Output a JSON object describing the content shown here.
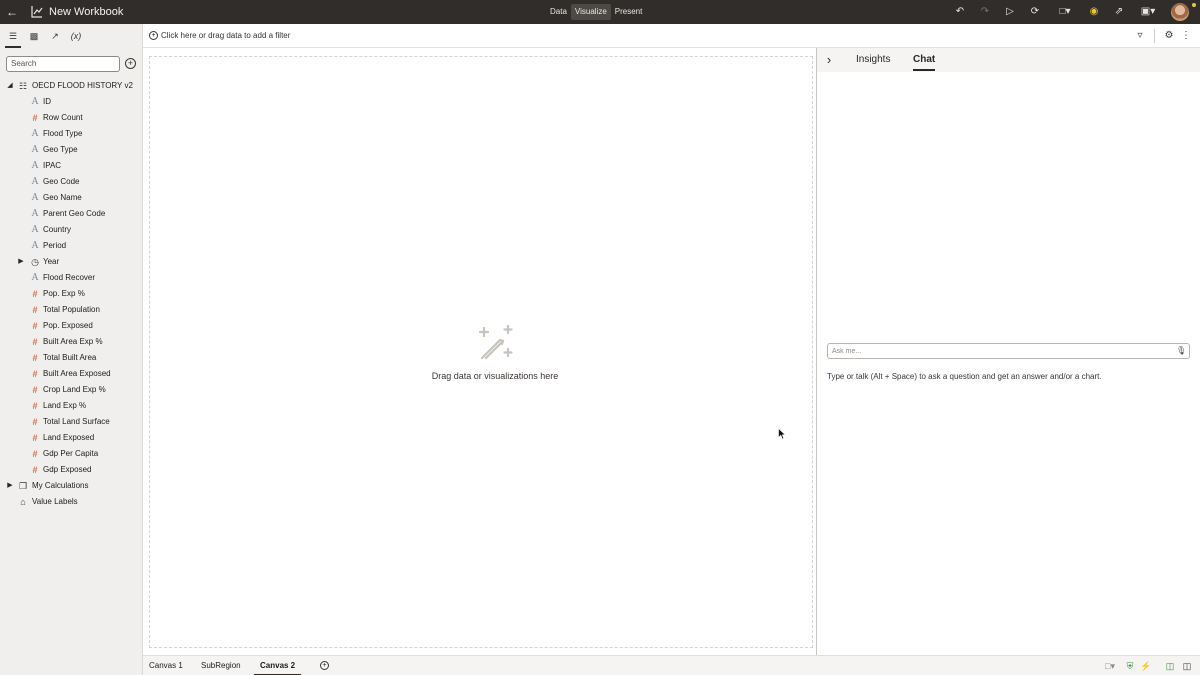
{
  "topbar": {
    "back_icon": "arrow-left-icon",
    "title": "New Workbook",
    "modes": [
      "Data",
      "Visualize",
      "Present"
    ],
    "active_mode": "Visualize",
    "icons": [
      "undo-icon",
      "redo-icon",
      "play-icon",
      "refresh-icon",
      "comment-icon",
      "bulb-icon",
      "export-icon",
      "save-icon",
      "avatar"
    ]
  },
  "left_panel": {
    "tab_icons": [
      "data-icon",
      "viz-icon",
      "analytics-icon",
      "calc-icon"
    ],
    "tab_labels": [
      "",
      "",
      "",
      "(x)"
    ],
    "search_placeholder": "Search",
    "dataset": "OECD FLOOD HISTORY v2",
    "fields": [
      {
        "label": "ID",
        "kind": "attribute"
      },
      {
        "label": "Row Count",
        "kind": "measure"
      },
      {
        "label": "Flood Type",
        "kind": "attribute"
      },
      {
        "label": "Geo Type",
        "kind": "attribute"
      },
      {
        "label": "IPAC",
        "kind": "attribute"
      },
      {
        "label": "Geo Code",
        "kind": "attribute"
      },
      {
        "label": "Geo Name",
        "kind": "attribute"
      },
      {
        "label": "Parent Geo Code",
        "kind": "attribute"
      },
      {
        "label": "Country",
        "kind": "attribute"
      },
      {
        "label": "Period",
        "kind": "attribute"
      },
      {
        "label": "Year",
        "kind": "time"
      },
      {
        "label": "Flood Recover",
        "kind": "attribute"
      },
      {
        "label": "Pop. Exp %",
        "kind": "measure"
      },
      {
        "label": "Total Population",
        "kind": "measure"
      },
      {
        "label": "Pop. Exposed",
        "kind": "measure"
      },
      {
        "label": "Built Area Exp %",
        "kind": "measure"
      },
      {
        "label": "Total Built Area",
        "kind": "measure"
      },
      {
        "label": "Built Area Exposed",
        "kind": "measure"
      },
      {
        "label": "Crop Land Exp %",
        "kind": "measure"
      },
      {
        "label": "Land Exp %",
        "kind": "measure"
      },
      {
        "label": "Total Land Surface",
        "kind": "measure"
      },
      {
        "label": "Land Exposed",
        "kind": "measure"
      },
      {
        "label": "Gdp Per Capita",
        "kind": "measure"
      },
      {
        "label": "Gdp Exposed",
        "kind": "measure"
      }
    ],
    "folders": [
      "My Calculations",
      "Value Labels"
    ]
  },
  "filter_bar": {
    "placeholder": "Click here or drag data to add a filter"
  },
  "canvas": {
    "hint": "Drag data or visualizations here"
  },
  "right_panel": {
    "tabs": [
      "Insights",
      "Chat"
    ],
    "active_tab": "Chat",
    "ask_placeholder": "Ask me...",
    "ask_hint": "Type or talk (Alt + Space) to ask a question and get an answer and/or a chart."
  },
  "bottom_bar": {
    "canvas_tabs": [
      "Canvas 1",
      "SubRegion",
      "Canvas 2"
    ],
    "active_canvas": "Canvas 2"
  },
  "colors": {
    "topbar_bg": "#312d2a",
    "panel_bg": "#f1efed",
    "attribute_icon": "#6e8fa8",
    "measure_icon": "#c7715a",
    "accent_green": "#3c8a3c"
  }
}
